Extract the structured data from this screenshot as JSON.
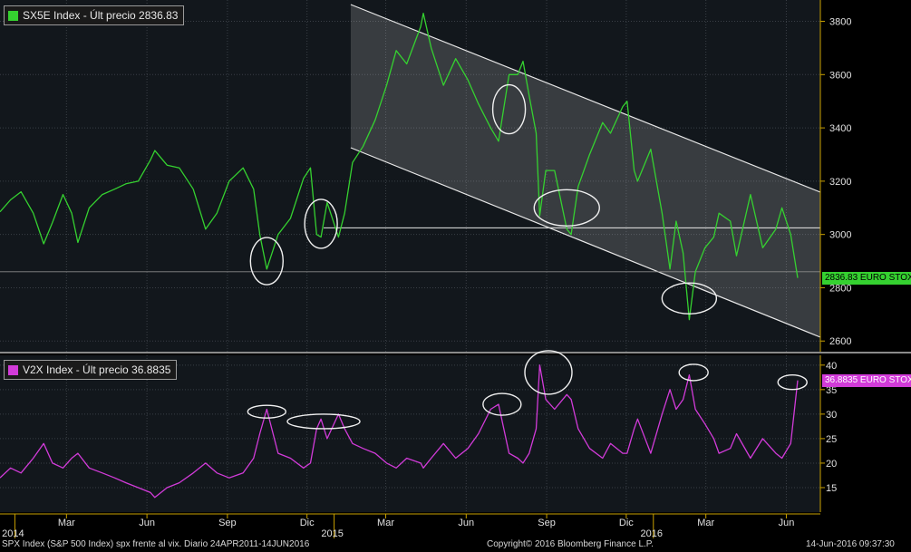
{
  "colors": {
    "sx5e_line": "#35d130",
    "v2x_line": "#d23bd9",
    "background": "#000000",
    "grid": "#3a3f46",
    "channel_fill": "#ffffff",
    "annotation": "#f0f0f0"
  },
  "top_panel": {
    "legend_text": "SX5E Index - Últ precio 2836.83",
    "last_value_label": "2836.83 EURO STOX"
  },
  "bottom_panel": {
    "legend_text": "V2X Index - Últ precio 36.8835",
    "last_value_label": "36.8835 EURO STOX"
  },
  "footer": {
    "left": "SPX Index (S&P 500 Index) spx frente al vix.  Diario 24APR2011-14JUN2016",
    "center": "Copyright© 2016 Bloomberg Finance L.P.",
    "right": "14-Jun-2016 09:37:30"
  },
  "chart_data": [
    {
      "type": "line",
      "title": "SX5E Index - Últ precio 2836.83",
      "series_name": "SX5E Index",
      "x_tick_labels": [
        "Mar",
        "Jun",
        "Sep",
        "Dic",
        "Mar",
        "Jun",
        "Sep",
        "Dic",
        "Mar",
        "Jun"
      ],
      "year_labels": [
        "2014",
        "2015",
        "2016"
      ],
      "y_ticks": [
        2600,
        2800,
        3000,
        3200,
        3400,
        3600,
        3800
      ],
      "ylim": [
        2560,
        3880
      ],
      "last_value": 2836.83,
      "x_date_range": [
        "2013-12-15",
        "2016-06-14"
      ],
      "points": [
        [
          "2013-12-15",
          3085
        ],
        [
          "2013-12-27",
          3130
        ],
        [
          "2014-01-08",
          3160
        ],
        [
          "2014-01-22",
          3080
        ],
        [
          "2014-02-03",
          2965
        ],
        [
          "2014-02-13",
          3045
        ],
        [
          "2014-02-25",
          3150
        ],
        [
          "2014-03-07",
          3080
        ],
        [
          "2014-03-14",
          2970
        ],
        [
          "2014-03-27",
          3100
        ],
        [
          "2014-04-11",
          3150
        ],
        [
          "2014-04-25",
          3170
        ],
        [
          "2014-05-08",
          3190
        ],
        [
          "2014-05-22",
          3200
        ],
        [
          "2014-06-05",
          3280
        ],
        [
          "2014-06-10",
          3315
        ],
        [
          "2014-06-24",
          3260
        ],
        [
          "2014-07-08",
          3250
        ],
        [
          "2014-07-24",
          3170
        ],
        [
          "2014-08-07",
          3020
        ],
        [
          "2014-08-20",
          3080
        ],
        [
          "2014-09-03",
          3200
        ],
        [
          "2014-09-19",
          3250
        ],
        [
          "2014-10-01",
          3170
        ],
        [
          "2014-10-08",
          3000
        ],
        [
          "2014-10-16",
          2870
        ],
        [
          "2014-10-29",
          3000
        ],
        [
          "2014-11-12",
          3060
        ],
        [
          "2014-11-27",
          3210
        ],
        [
          "2014-12-05",
          3250
        ],
        [
          "2014-12-12",
          3000
        ],
        [
          "2014-12-17",
          2990
        ],
        [
          "2014-12-24",
          3120
        ],
        [
          "2015-01-06",
          2990
        ],
        [
          "2015-01-13",
          3080
        ],
        [
          "2015-01-22",
          3270
        ],
        [
          "2015-02-03",
          3330
        ],
        [
          "2015-02-17",
          3430
        ],
        [
          "2015-03-02",
          3560
        ],
        [
          "2015-03-13",
          3690
        ],
        [
          "2015-03-25",
          3640
        ],
        [
          "2015-04-10",
          3780
        ],
        [
          "2015-04-13",
          3830
        ],
        [
          "2015-04-22",
          3700
        ],
        [
          "2015-05-06",
          3560
        ],
        [
          "2015-05-20",
          3660
        ],
        [
          "2015-06-03",
          3580
        ],
        [
          "2015-06-15",
          3490
        ],
        [
          "2015-06-29",
          3400
        ],
        [
          "2015-07-08",
          3350
        ],
        [
          "2015-07-20",
          3600
        ],
        [
          "2015-07-30",
          3600
        ],
        [
          "2015-08-05",
          3650
        ],
        [
          "2015-08-12",
          3520
        ],
        [
          "2015-08-20",
          3380
        ],
        [
          "2015-08-24",
          3070
        ],
        [
          "2015-08-31",
          3240
        ],
        [
          "2015-09-10",
          3240
        ],
        [
          "2015-09-24",
          3020
        ],
        [
          "2015-09-29",
          3000
        ],
        [
          "2015-10-07",
          3180
        ],
        [
          "2015-10-20",
          3300
        ],
        [
          "2015-11-04",
          3420
        ],
        [
          "2015-11-13",
          3380
        ],
        [
          "2015-11-27",
          3480
        ],
        [
          "2015-12-02",
          3500
        ],
        [
          "2015-12-10",
          3240
        ],
        [
          "2015-12-14",
          3200
        ],
        [
          "2015-12-29",
          3320
        ],
        [
          "2016-01-11",
          3080
        ],
        [
          "2016-01-20",
          2870
        ],
        [
          "2016-01-27",
          3050
        ],
        [
          "2016-02-04",
          2930
        ],
        [
          "2016-02-11",
          2680
        ],
        [
          "2016-02-18",
          2860
        ],
        [
          "2016-02-29",
          2950
        ],
        [
          "2016-03-10",
          2990
        ],
        [
          "2016-03-16",
          3080
        ],
        [
          "2016-03-29",
          3050
        ],
        [
          "2016-04-05",
          2920
        ],
        [
          "2016-04-21",
          3150
        ],
        [
          "2016-05-05",
          2950
        ],
        [
          "2016-05-20",
          3020
        ],
        [
          "2016-05-27",
          3100
        ],
        [
          "2016-06-06",
          3000
        ],
        [
          "2016-06-14",
          2836.83
        ]
      ]
    },
    {
      "type": "line",
      "title": "V2X Index - Últ precio 36.8835",
      "series_name": "V2X Index",
      "x_tick_labels": [
        "Mar",
        "Jun",
        "Sep",
        "Dic",
        "Mar",
        "Jun",
        "Sep",
        "Dic",
        "Mar",
        "Jun"
      ],
      "year_labels": [
        "2014",
        "2015",
        "2016"
      ],
      "y_ticks": [
        15,
        20,
        25,
        30,
        35,
        40
      ],
      "ylim": [
        10,
        42
      ],
      "last_value": 36.8835,
      "x_date_range": [
        "2013-12-15",
        "2016-06-14"
      ],
      "points": [
        [
          "2013-12-15",
          17
        ],
        [
          "2013-12-27",
          19
        ],
        [
          "2014-01-08",
          18
        ],
        [
          "2014-01-22",
          21
        ],
        [
          "2014-02-03",
          24
        ],
        [
          "2014-02-13",
          20
        ],
        [
          "2014-02-25",
          19
        ],
        [
          "2014-03-07",
          21
        ],
        [
          "2014-03-14",
          22
        ],
        [
          "2014-03-27",
          19
        ],
        [
          "2014-04-11",
          18
        ],
        [
          "2014-04-25",
          17
        ],
        [
          "2014-05-08",
          16
        ],
        [
          "2014-05-22",
          15
        ],
        [
          "2014-06-05",
          14
        ],
        [
          "2014-06-10",
          13
        ],
        [
          "2014-06-24",
          15
        ],
        [
          "2014-07-08",
          16
        ],
        [
          "2014-07-24",
          18
        ],
        [
          "2014-08-07",
          20
        ],
        [
          "2014-08-20",
          18
        ],
        [
          "2014-09-03",
          17
        ],
        [
          "2014-09-19",
          18
        ],
        [
          "2014-10-01",
          21
        ],
        [
          "2014-10-08",
          26
        ],
        [
          "2014-10-16",
          31
        ],
        [
          "2014-10-29",
          22
        ],
        [
          "2014-11-12",
          21
        ],
        [
          "2014-11-27",
          19
        ],
        [
          "2014-12-05",
          20
        ],
        [
          "2014-12-12",
          27
        ],
        [
          "2014-12-17",
          29
        ],
        [
          "2014-12-24",
          25
        ],
        [
          "2015-01-06",
          30
        ],
        [
          "2015-01-13",
          27
        ],
        [
          "2015-01-22",
          24
        ],
        [
          "2015-02-03",
          23
        ],
        [
          "2015-02-17",
          22
        ],
        [
          "2015-03-02",
          20
        ],
        [
          "2015-03-13",
          19
        ],
        [
          "2015-03-25",
          21
        ],
        [
          "2015-04-10",
          20
        ],
        [
          "2015-04-13",
          19
        ],
        [
          "2015-04-22",
          21
        ],
        [
          "2015-05-06",
          24
        ],
        [
          "2015-05-20",
          21
        ],
        [
          "2015-06-03",
          23
        ],
        [
          "2015-06-15",
          26
        ],
        [
          "2015-06-29",
          31
        ],
        [
          "2015-07-08",
          32
        ],
        [
          "2015-07-20",
          22
        ],
        [
          "2015-07-30",
          21
        ],
        [
          "2015-08-05",
          20
        ],
        [
          "2015-08-12",
          22
        ],
        [
          "2015-08-20",
          27
        ],
        [
          "2015-08-24",
          40
        ],
        [
          "2015-08-31",
          33
        ],
        [
          "2015-09-10",
          31
        ],
        [
          "2015-09-24",
          34
        ],
        [
          "2015-09-29",
          33
        ],
        [
          "2015-10-07",
          27
        ],
        [
          "2015-10-20",
          23
        ],
        [
          "2015-11-04",
          21
        ],
        [
          "2015-11-13",
          24
        ],
        [
          "2015-11-27",
          22
        ],
        [
          "2015-12-02",
          22
        ],
        [
          "2015-12-10",
          27
        ],
        [
          "2015-12-14",
          29
        ],
        [
          "2015-12-29",
          22
        ],
        [
          "2016-01-11",
          30
        ],
        [
          "2016-01-20",
          35
        ],
        [
          "2016-01-27",
          31
        ],
        [
          "2016-02-04",
          33
        ],
        [
          "2016-02-11",
          38
        ],
        [
          "2016-02-18",
          31
        ],
        [
          "2016-02-29",
          28
        ],
        [
          "2016-03-10",
          25
        ],
        [
          "2016-03-16",
          22
        ],
        [
          "2016-03-29",
          23
        ],
        [
          "2016-04-05",
          26
        ],
        [
          "2016-04-21",
          21
        ],
        [
          "2016-05-05",
          25
        ],
        [
          "2016-05-20",
          22
        ],
        [
          "2016-05-27",
          21
        ],
        [
          "2016-06-06",
          24
        ],
        [
          "2016-06-14",
          36.8835
        ]
      ]
    }
  ]
}
